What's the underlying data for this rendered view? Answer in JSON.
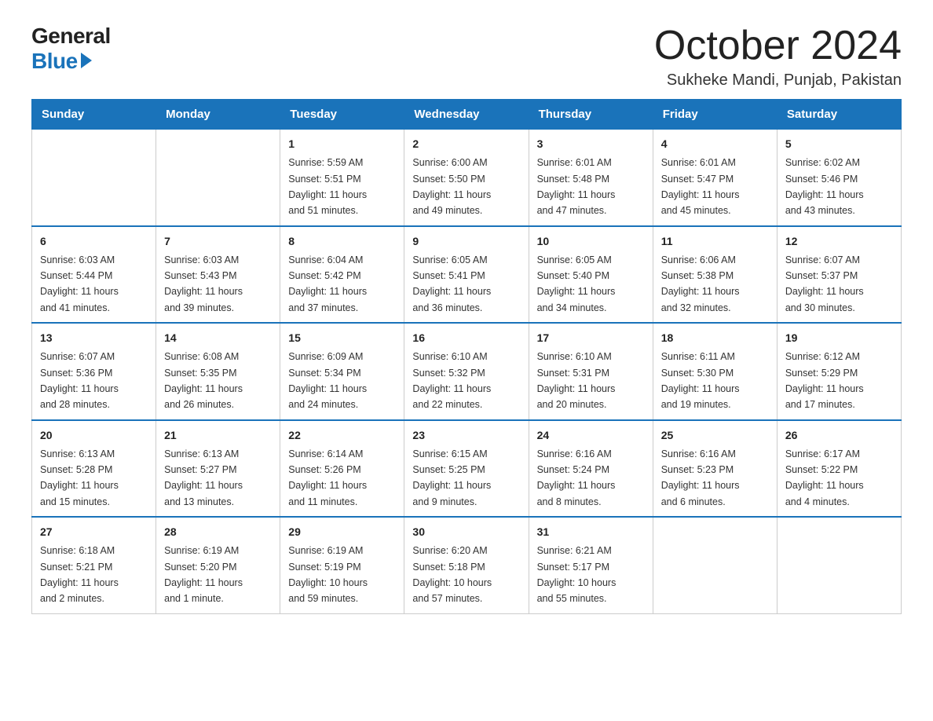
{
  "logo": {
    "general": "General",
    "blue": "Blue"
  },
  "title": "October 2024",
  "subtitle": "Sukheke Mandi, Punjab, Pakistan",
  "weekdays": [
    "Sunday",
    "Monday",
    "Tuesday",
    "Wednesday",
    "Thursday",
    "Friday",
    "Saturday"
  ],
  "weeks": [
    [
      {
        "day": "",
        "info": ""
      },
      {
        "day": "",
        "info": ""
      },
      {
        "day": "1",
        "info": "Sunrise: 5:59 AM\nSunset: 5:51 PM\nDaylight: 11 hours\nand 51 minutes."
      },
      {
        "day": "2",
        "info": "Sunrise: 6:00 AM\nSunset: 5:50 PM\nDaylight: 11 hours\nand 49 minutes."
      },
      {
        "day": "3",
        "info": "Sunrise: 6:01 AM\nSunset: 5:48 PM\nDaylight: 11 hours\nand 47 minutes."
      },
      {
        "day": "4",
        "info": "Sunrise: 6:01 AM\nSunset: 5:47 PM\nDaylight: 11 hours\nand 45 minutes."
      },
      {
        "day": "5",
        "info": "Sunrise: 6:02 AM\nSunset: 5:46 PM\nDaylight: 11 hours\nand 43 minutes."
      }
    ],
    [
      {
        "day": "6",
        "info": "Sunrise: 6:03 AM\nSunset: 5:44 PM\nDaylight: 11 hours\nand 41 minutes."
      },
      {
        "day": "7",
        "info": "Sunrise: 6:03 AM\nSunset: 5:43 PM\nDaylight: 11 hours\nand 39 minutes."
      },
      {
        "day": "8",
        "info": "Sunrise: 6:04 AM\nSunset: 5:42 PM\nDaylight: 11 hours\nand 37 minutes."
      },
      {
        "day": "9",
        "info": "Sunrise: 6:05 AM\nSunset: 5:41 PM\nDaylight: 11 hours\nand 36 minutes."
      },
      {
        "day": "10",
        "info": "Sunrise: 6:05 AM\nSunset: 5:40 PM\nDaylight: 11 hours\nand 34 minutes."
      },
      {
        "day": "11",
        "info": "Sunrise: 6:06 AM\nSunset: 5:38 PM\nDaylight: 11 hours\nand 32 minutes."
      },
      {
        "day": "12",
        "info": "Sunrise: 6:07 AM\nSunset: 5:37 PM\nDaylight: 11 hours\nand 30 minutes."
      }
    ],
    [
      {
        "day": "13",
        "info": "Sunrise: 6:07 AM\nSunset: 5:36 PM\nDaylight: 11 hours\nand 28 minutes."
      },
      {
        "day": "14",
        "info": "Sunrise: 6:08 AM\nSunset: 5:35 PM\nDaylight: 11 hours\nand 26 minutes."
      },
      {
        "day": "15",
        "info": "Sunrise: 6:09 AM\nSunset: 5:34 PM\nDaylight: 11 hours\nand 24 minutes."
      },
      {
        "day": "16",
        "info": "Sunrise: 6:10 AM\nSunset: 5:32 PM\nDaylight: 11 hours\nand 22 minutes."
      },
      {
        "day": "17",
        "info": "Sunrise: 6:10 AM\nSunset: 5:31 PM\nDaylight: 11 hours\nand 20 minutes."
      },
      {
        "day": "18",
        "info": "Sunrise: 6:11 AM\nSunset: 5:30 PM\nDaylight: 11 hours\nand 19 minutes."
      },
      {
        "day": "19",
        "info": "Sunrise: 6:12 AM\nSunset: 5:29 PM\nDaylight: 11 hours\nand 17 minutes."
      }
    ],
    [
      {
        "day": "20",
        "info": "Sunrise: 6:13 AM\nSunset: 5:28 PM\nDaylight: 11 hours\nand 15 minutes."
      },
      {
        "day": "21",
        "info": "Sunrise: 6:13 AM\nSunset: 5:27 PM\nDaylight: 11 hours\nand 13 minutes."
      },
      {
        "day": "22",
        "info": "Sunrise: 6:14 AM\nSunset: 5:26 PM\nDaylight: 11 hours\nand 11 minutes."
      },
      {
        "day": "23",
        "info": "Sunrise: 6:15 AM\nSunset: 5:25 PM\nDaylight: 11 hours\nand 9 minutes."
      },
      {
        "day": "24",
        "info": "Sunrise: 6:16 AM\nSunset: 5:24 PM\nDaylight: 11 hours\nand 8 minutes."
      },
      {
        "day": "25",
        "info": "Sunrise: 6:16 AM\nSunset: 5:23 PM\nDaylight: 11 hours\nand 6 minutes."
      },
      {
        "day": "26",
        "info": "Sunrise: 6:17 AM\nSunset: 5:22 PM\nDaylight: 11 hours\nand 4 minutes."
      }
    ],
    [
      {
        "day": "27",
        "info": "Sunrise: 6:18 AM\nSunset: 5:21 PM\nDaylight: 11 hours\nand 2 minutes."
      },
      {
        "day": "28",
        "info": "Sunrise: 6:19 AM\nSunset: 5:20 PM\nDaylight: 11 hours\nand 1 minute."
      },
      {
        "day": "29",
        "info": "Sunrise: 6:19 AM\nSunset: 5:19 PM\nDaylight: 10 hours\nand 59 minutes."
      },
      {
        "day": "30",
        "info": "Sunrise: 6:20 AM\nSunset: 5:18 PM\nDaylight: 10 hours\nand 57 minutes."
      },
      {
        "day": "31",
        "info": "Sunrise: 6:21 AM\nSunset: 5:17 PM\nDaylight: 10 hours\nand 55 minutes."
      },
      {
        "day": "",
        "info": ""
      },
      {
        "day": "",
        "info": ""
      }
    ]
  ]
}
